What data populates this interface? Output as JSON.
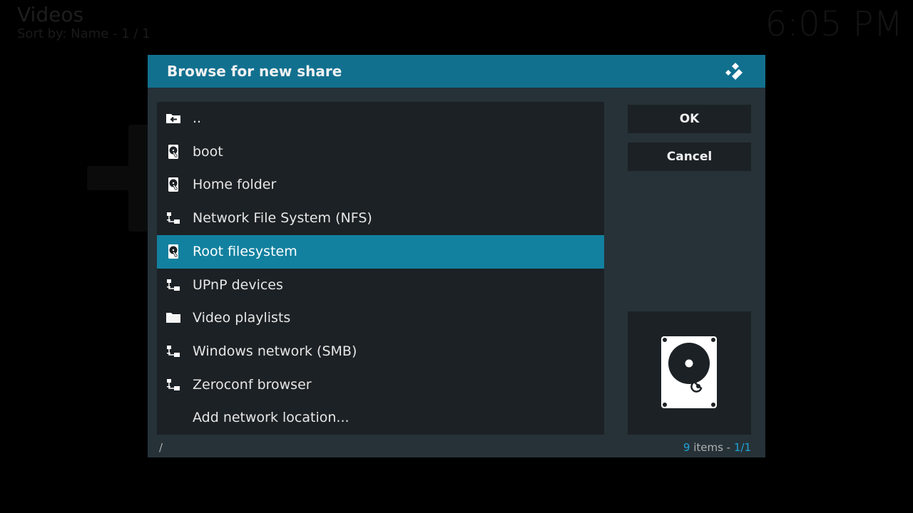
{
  "background": {
    "title": "Videos",
    "subtitle": "Sort by: Name  -  1 / 1",
    "clock": "6:05 PM"
  },
  "dialog": {
    "title": "Browse for new share",
    "logo_icon": "kodi-logo-icon",
    "items": [
      {
        "label": "..",
        "icon": "folder-back-icon"
      },
      {
        "label": "boot",
        "icon": "harddisk-icon"
      },
      {
        "label": "Home folder",
        "icon": "harddisk-icon"
      },
      {
        "label": "Network File System (NFS)",
        "icon": "network-icon"
      },
      {
        "label": "Root filesystem",
        "icon": "harddisk-icon",
        "selected": true
      },
      {
        "label": "UPnP devices",
        "icon": "network-icon"
      },
      {
        "label": "Video playlists",
        "icon": "folder-icon"
      },
      {
        "label": "Windows network (SMB)",
        "icon": "network-icon"
      },
      {
        "label": "Zeroconf browser",
        "icon": "network-icon"
      },
      {
        "label": "Add network location...",
        "icon": ""
      }
    ],
    "ok_label": "OK",
    "cancel_label": "Cancel",
    "preview_icon": "harddisk-large-icon",
    "footer": {
      "path": "/",
      "count": "9",
      "items_text": " items - ",
      "page": "1/1"
    },
    "colors": {
      "header": "#12708f",
      "selected_row": "#12819f",
      "accent": "#1ea3d6"
    }
  }
}
